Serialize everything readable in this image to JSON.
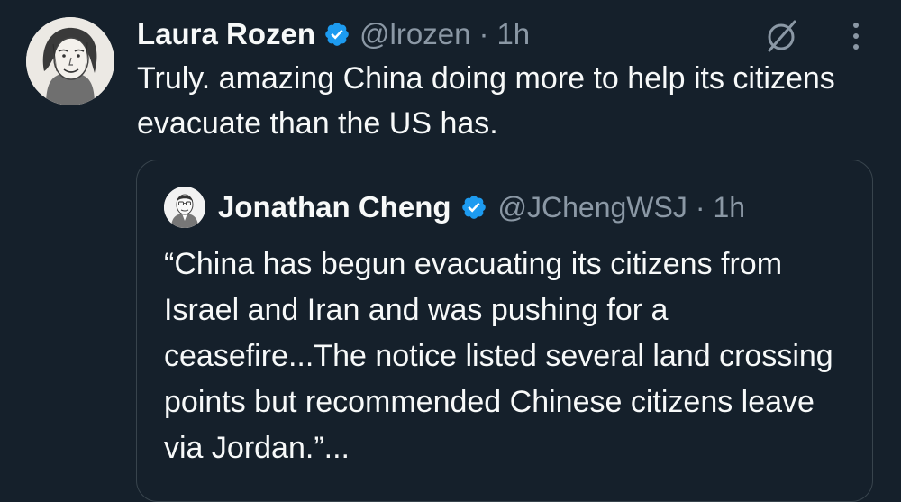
{
  "tweet": {
    "display_name": "Laura Rozen",
    "handle": "@lrozen",
    "separator": "·",
    "time": "1h",
    "text": "Truly. amazing China doing more to help its citizens evacuate than the US has."
  },
  "quoted_tweet": {
    "display_name": "Jonathan Cheng",
    "handle": "@JChengWSJ",
    "separator": "·",
    "time": "1h",
    "text": "“China has begun evacuating its citizens from Israel and Iran and was pushing for a ceasefire...The notice listed several land crossing points but recommended Chinese citizens leave via Jordan.”..."
  },
  "icons": {
    "verified": "verified-badge-icon",
    "grok": "grok-icon",
    "more": "more-vertical-icon"
  },
  "colors": {
    "background": "#15202b",
    "text": "#f7f9f9",
    "secondary_text": "#8b98a5",
    "verified_blue": "#1d9bf0",
    "border": "#38444d"
  }
}
